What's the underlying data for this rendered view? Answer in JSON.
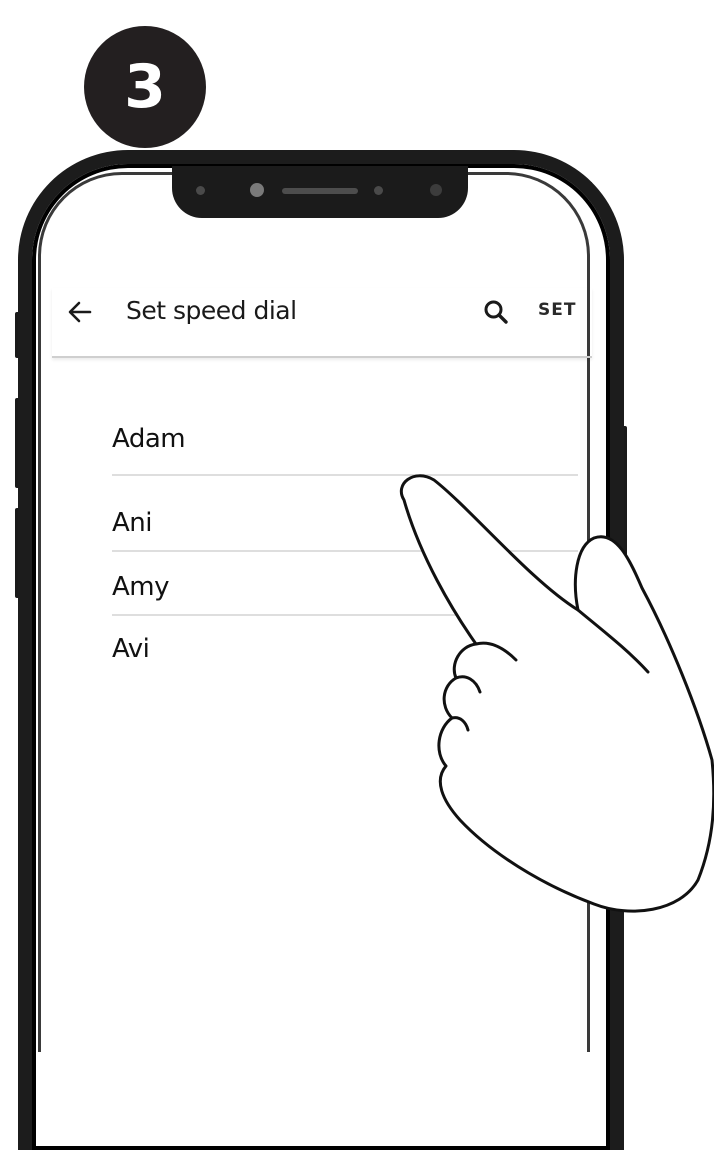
{
  "step": {
    "number": "3"
  },
  "app_bar": {
    "back_icon": "arrow-left-icon",
    "title": "Set speed dial",
    "search_icon": "search-icon",
    "set_label": "SET"
  },
  "contacts": [
    {
      "name": "Adam"
    },
    {
      "name": "Ani"
    },
    {
      "name": "Amy"
    },
    {
      "name": "Avi"
    }
  ],
  "colors": {
    "badge": "#231f20",
    "phone_frame": "#1c1c1c",
    "divider": "#dedede"
  }
}
